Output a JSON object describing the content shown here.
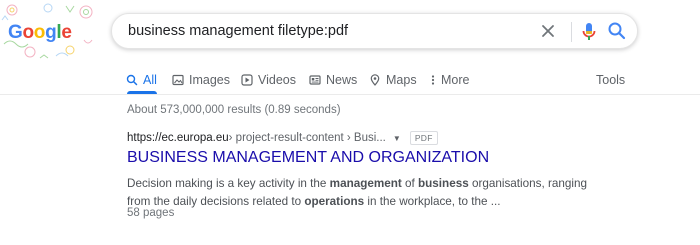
{
  "logo": {
    "letters": [
      "G",
      "o",
      "o",
      "g",
      "l",
      "e"
    ],
    "colors": [
      "#4285f4",
      "#ea4335",
      "#fbbc05",
      "#4285f4",
      "#34a853",
      "#ea4335"
    ]
  },
  "search": {
    "query": "business management filetype:pdf",
    "icons": {
      "clear": "close-icon",
      "voice": "microphone-icon",
      "submit": "search-icon"
    }
  },
  "tabs": [
    {
      "label": "All",
      "icon": "search-icon",
      "active": true
    },
    {
      "label": "Images",
      "icon": "image-icon"
    },
    {
      "label": "Videos",
      "icon": "video-icon"
    },
    {
      "label": "News",
      "icon": "news-icon"
    },
    {
      "label": "Maps",
      "icon": "map-pin-icon"
    },
    {
      "label": "More",
      "icon": "more-vert-icon"
    },
    {
      "label": "Tools"
    }
  ],
  "stats": "About 573,000,000 results (0.89 seconds)",
  "result": {
    "domain": "https://ec.europa.eu",
    "path": " › project-result-content › Busi...",
    "caret": "▼",
    "filetype": "PDF",
    "title": "BUSINESS MANAGEMENT AND ORGANIZATION",
    "snippet": {
      "s1": "Decision making is a key activity in the ",
      "b1": "management",
      "s2": " of ",
      "b2": "business",
      "s3": " organisations, ranging from the daily decisions related to ",
      "b3": "operations",
      "s4": " in the workplace, to the ..."
    },
    "pages": "58 pages"
  },
  "colors": {
    "accent": "#1a73e8",
    "link": "#1a0dab",
    "muted": "#70757a",
    "text": "#202124"
  }
}
